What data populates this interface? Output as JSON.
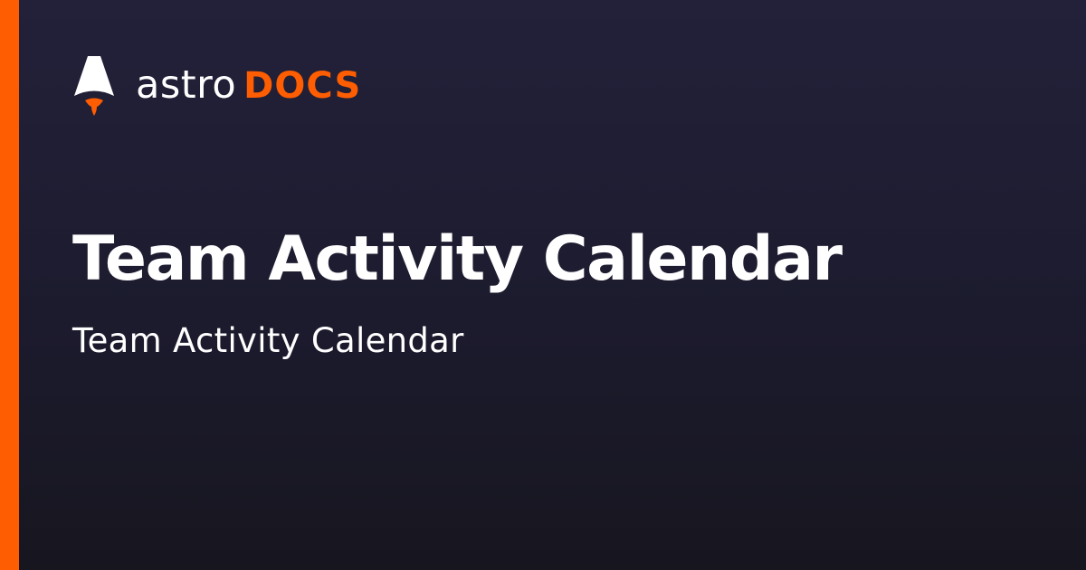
{
  "brand": {
    "wordmark_primary": "astro",
    "wordmark_secondary": "DOCS",
    "accent_color": "#ff5d01",
    "logo_icon": "astro-rocket-logo"
  },
  "page": {
    "title": "Team Activity Calendar",
    "subtitle": "Team Activity Calendar"
  },
  "colors": {
    "background": "#1e1c2e",
    "text": "#ffffff",
    "accent": "#ff5d01"
  }
}
